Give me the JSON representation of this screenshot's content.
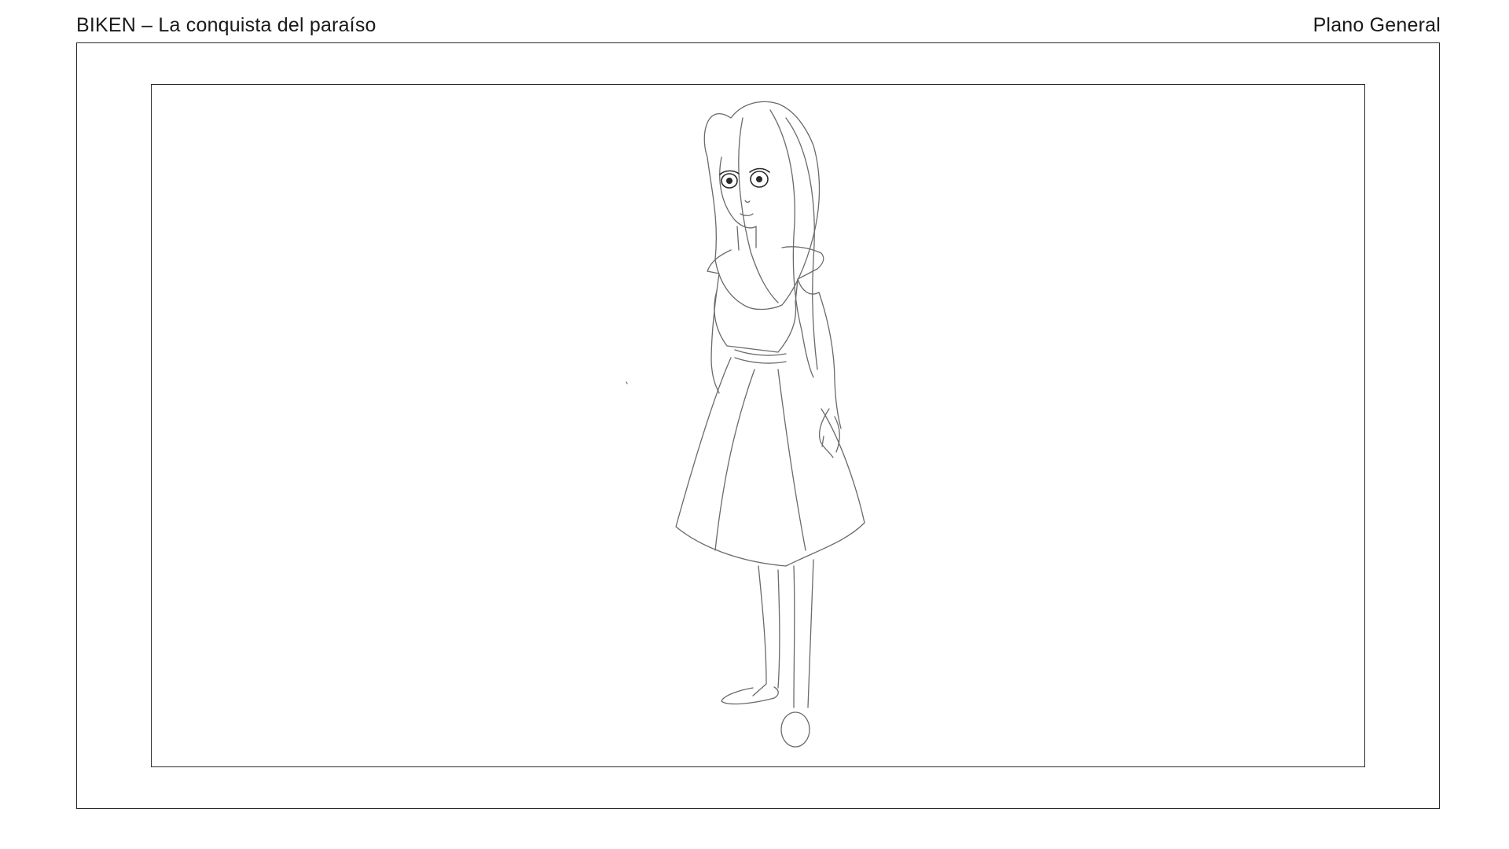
{
  "header": {
    "title": "BIKEN – La conquista del paraíso",
    "shot_type": "Plano General"
  },
  "panel": {
    "illustration": "girl-standing-line-sketch"
  }
}
